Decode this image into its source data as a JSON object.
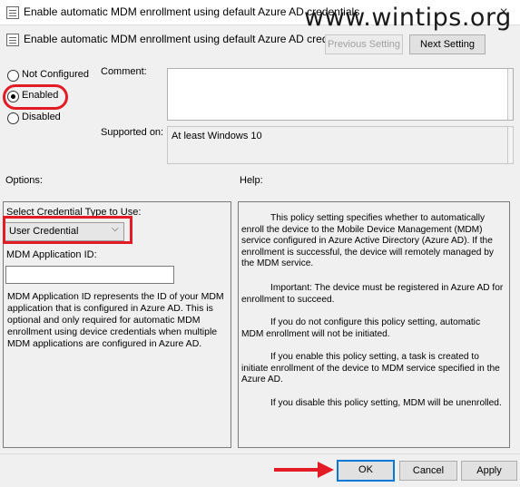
{
  "window": {
    "title": "Enable automatic MDM enrollment using default Azure AD credentials",
    "close_glyph": "×"
  },
  "watermark": "www.wintips.org",
  "header": {
    "policy_title": "Enable automatic MDM enrollment using default Azure AD credentials",
    "previous_setting": "Previous Setting",
    "next_setting": "Next Setting"
  },
  "state": {
    "not_configured": "Not Configured",
    "enabled": "Enabled",
    "disabled": "Disabled",
    "selected": "Enabled"
  },
  "comment": {
    "label": "Comment:",
    "value": ""
  },
  "supported_on": {
    "label": "Supported on:",
    "value": "At least Windows 10"
  },
  "options": {
    "label": "Options:",
    "credential_type_label": "Select Credential Type to Use:",
    "credential_type_value": "User Credential",
    "app_id_label": "MDM Application ID:",
    "app_id_value": "",
    "description": "MDM Application ID represents the ID of your MDM application that is configured in Azure AD. This is optional and only required for automatic MDM enrollment using device credentials when multiple MDM applications are configured in Azure AD."
  },
  "help": {
    "label": "Help:",
    "p1": "This policy setting specifies whether to automatically enroll the device to the Mobile Device Management (MDM) service configured in Azure Active Directory (Azure AD). If the enrollment is successful, the device will remotely managed by the MDM service.",
    "p2": "Important: The device must be registered in Azure AD for enrollment to succeed.",
    "p3": "If you do not configure this policy setting, automatic MDM enrollment will not be initiated.",
    "p4": "If you enable this policy setting, a task is created to initiate enrollment of the device to MDM service specified in the Azure AD.",
    "p5": "If you disable this policy setting, MDM will be unenrolled."
  },
  "footer": {
    "ok": "OK",
    "cancel": "Cancel",
    "apply": "Apply"
  },
  "colors": {
    "highlight": "#e21b24",
    "focus": "#0078d7",
    "dialog_bg": "#f0f0f0"
  }
}
